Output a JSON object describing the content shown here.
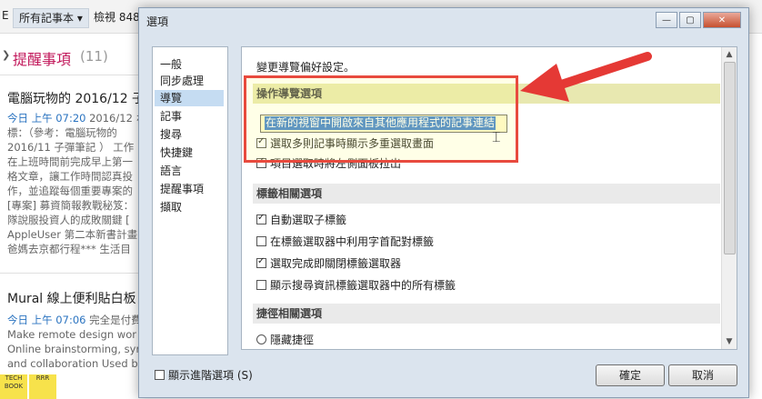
{
  "background": {
    "toolbar_cut": "E",
    "notebook_selector": "所有記事本",
    "view_label": "檢視 848",
    "section_title": "提醒事項",
    "section_count": "(11)",
    "notes": [
      {
        "title": "電腦玩物的 2016/12 子",
        "time": "今日 上午 07:20",
        "body": " 2016/12 ホ\n標：（參考：電腦玩物的\n2016/11 子彈筆記 ） 工作\n在上班時間前完成早上第一\n格文章，讓工作時間認真投\n作，並追蹤每個重要專案的\n[專案] 募資簡報教戰秘笈：\n隊說服投資人的成敗關鍵 [\nAppleUser 第二本新書計畫\n爸媽去京都行程*** 生活目"
      },
      {
        "title": "Mural 線上便利貼白板",
        "time": "今日 上午 07:06",
        "body": " 完全是付費\nMake remote design wor\nOnline brainstorming, syn\nand collaboration Used b"
      }
    ],
    "thumb_labels": [
      "TECH BOOK",
      "RRR"
    ]
  },
  "dialog": {
    "title": "選項",
    "categories": [
      "一般",
      "同步處理",
      "導覽",
      "記事",
      "搜尋",
      "快捷鍵",
      "語言",
      "提醒事項",
      "擷取"
    ],
    "active_category": "導覽",
    "intro": "變更導覽偏好設定。",
    "sections": [
      {
        "heading": "操作導覽選項",
        "options": [
          {
            "label": "在新的視窗中開啟來自其他應用程式的記事連結",
            "checked": true,
            "selected": true
          },
          {
            "label": "選取多則記事時顯示多重選取畫面",
            "checked": true
          },
          {
            "label": "項目選取時將左側面板拉出",
            "checked": true
          }
        ]
      },
      {
        "heading": "標籤相關選項",
        "options": [
          {
            "label": "自動選取子標籤",
            "checked": true
          },
          {
            "label": "在標籤選取器中利用字首配對標籤",
            "checked": false
          },
          {
            "label": "選取完成即關閉標籤選取器",
            "checked": true
          },
          {
            "label": "顯示搜尋資訊標籤選取器中的所有標籤",
            "checked": false
          }
        ]
      },
      {
        "heading": "捷徑相關選項",
        "options": [
          {
            "label": "隱藏捷徑",
            "radio": true
          }
        ]
      }
    ],
    "show_advanced": "顯示進階選項 (S)",
    "ok_label": "確定",
    "cancel_label": "取消",
    "minimize_glyph": "—",
    "maximize_glyph": "▢",
    "close_glyph": "✕"
  },
  "colors": {
    "highlight_border": "#e84a3e",
    "selection": "#3d7fd0",
    "active_category": "#c5dcf2",
    "arrow": "#e53935"
  }
}
